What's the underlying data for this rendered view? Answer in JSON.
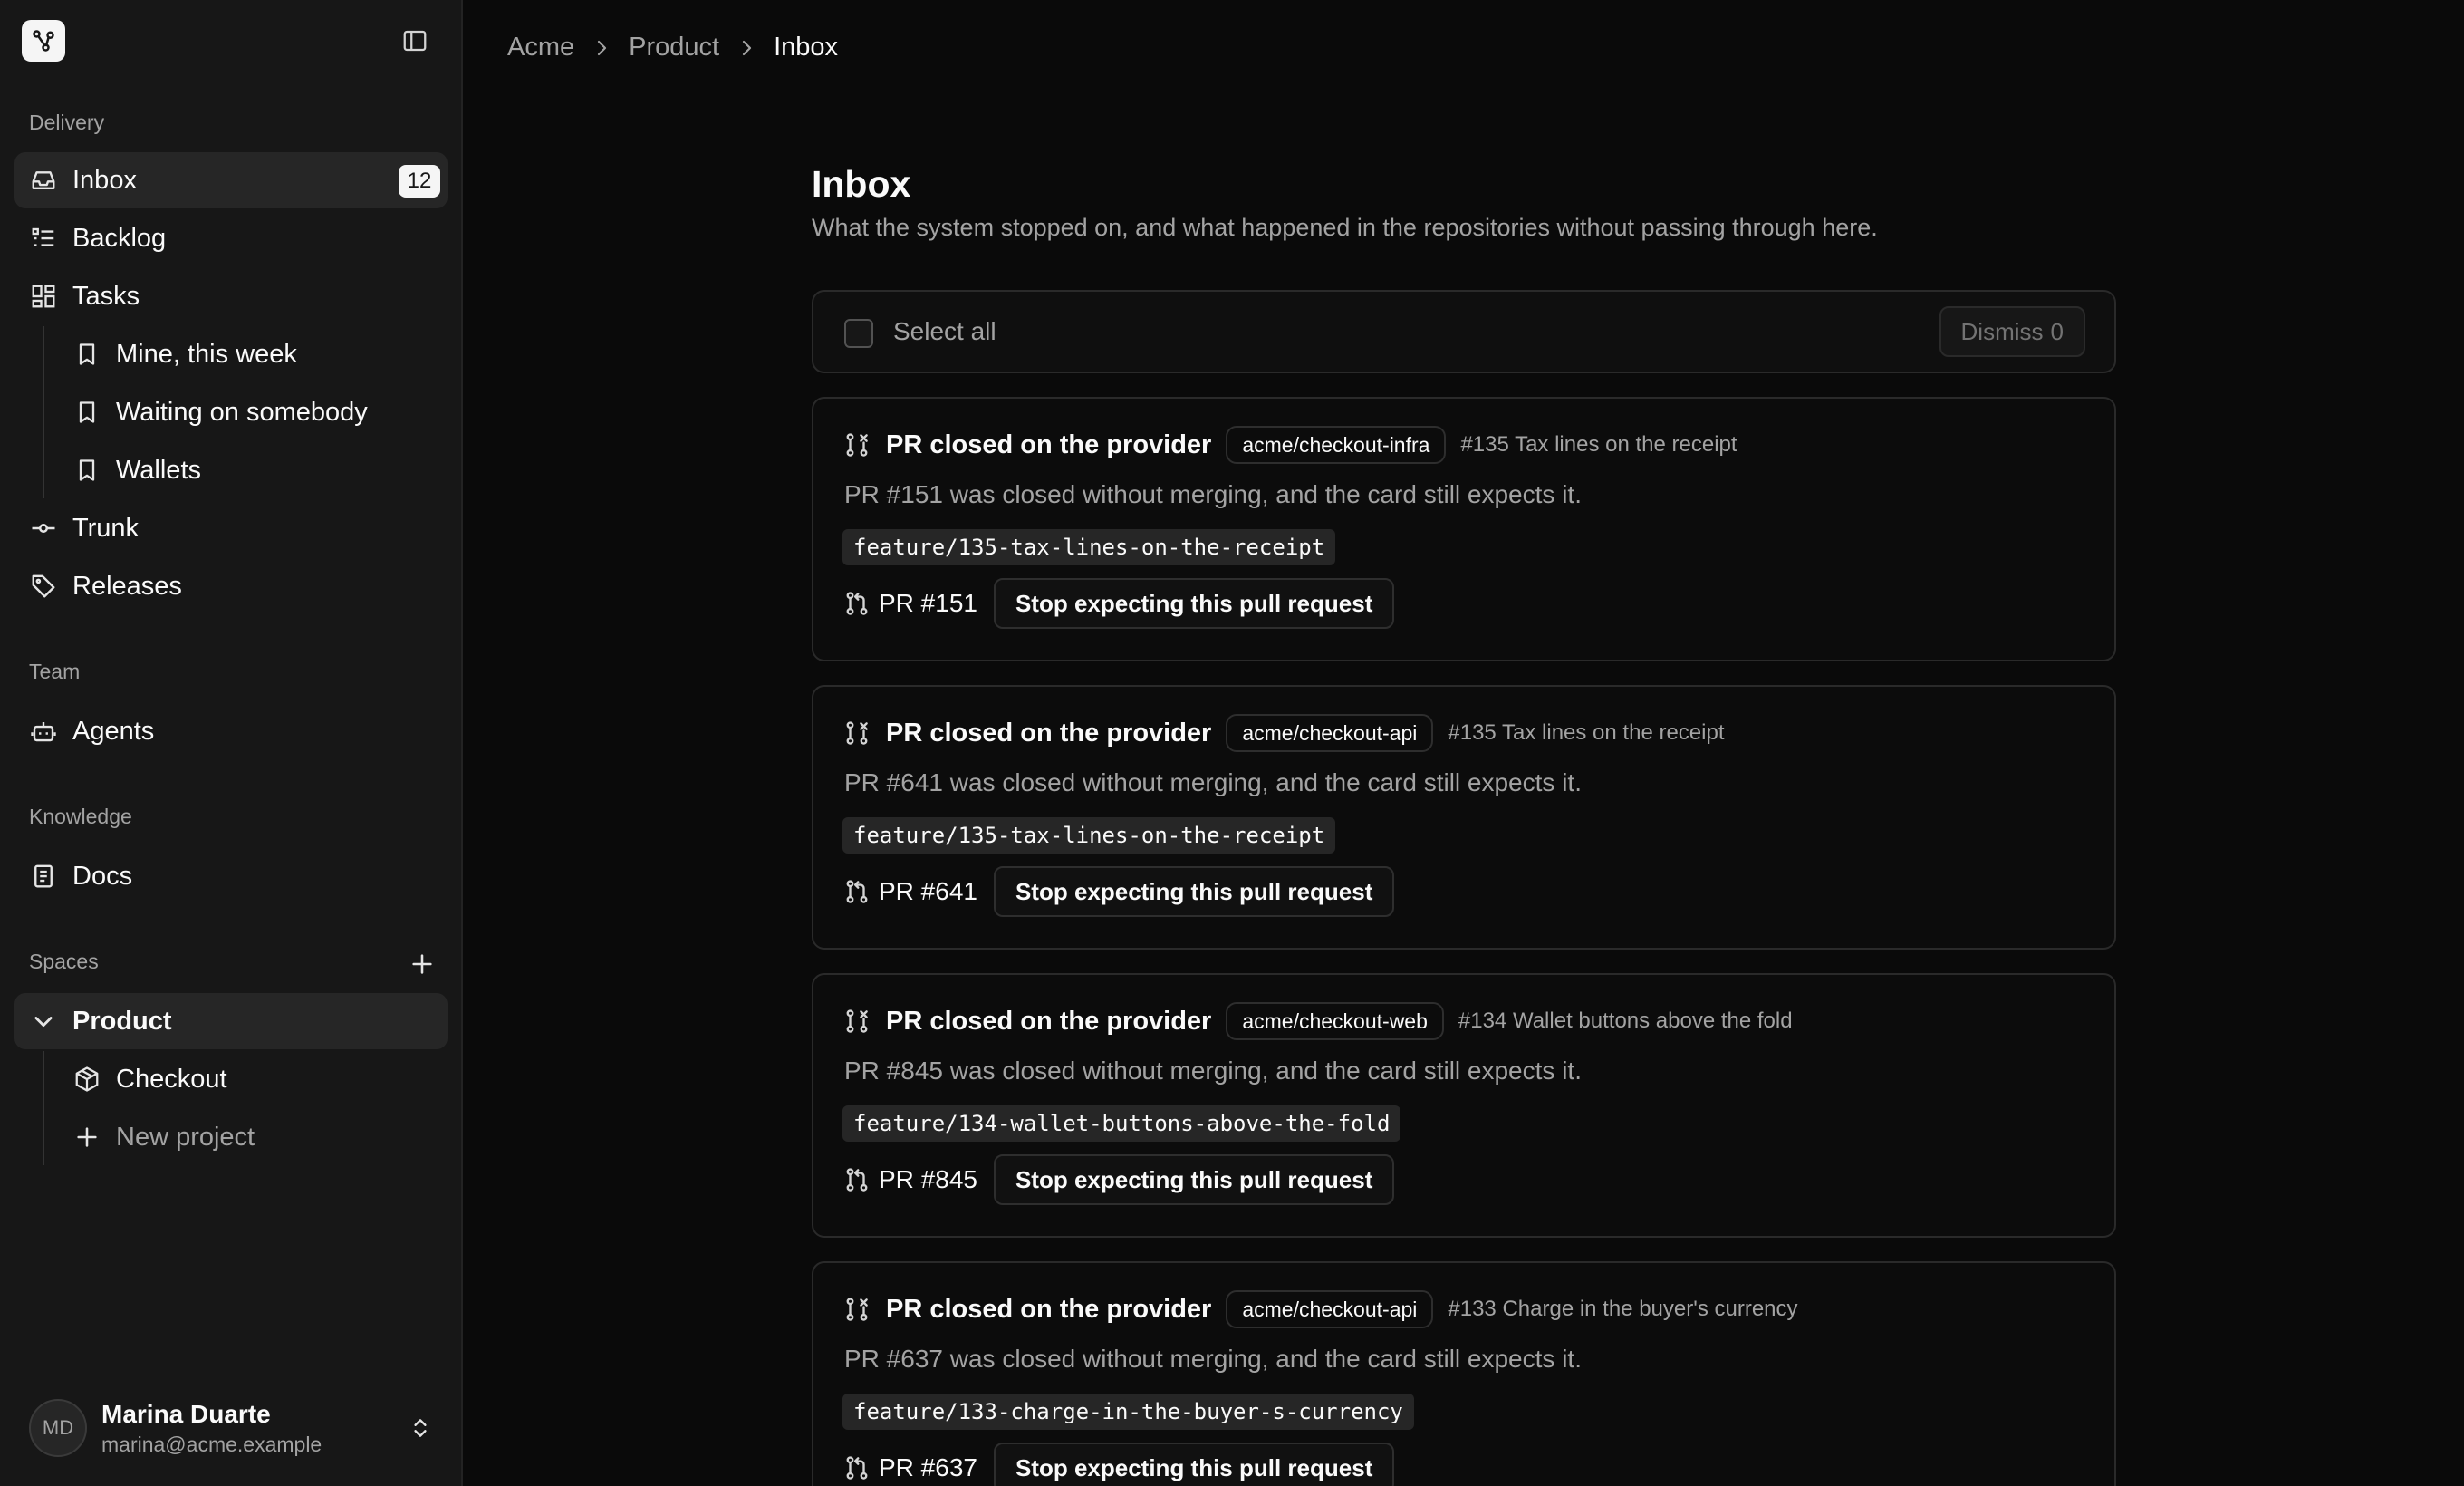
{
  "sidebar": {
    "groups": {
      "delivery": "Delivery",
      "team": "Team",
      "knowledge": "Knowledge",
      "spaces": "Spaces"
    },
    "items": {
      "inbox": {
        "label": "Inbox",
        "badge": "12",
        "icon": "inbox-icon"
      },
      "backlog": {
        "label": "Backlog",
        "icon": "list-icon"
      },
      "tasks": {
        "label": "Tasks",
        "icon": "layout-grid-icon"
      },
      "mine": {
        "label": "Mine, this week",
        "icon": "bookmark-icon"
      },
      "waiting": {
        "label": "Waiting on somebody",
        "icon": "bookmark-icon"
      },
      "wallets": {
        "label": "Wallets",
        "icon": "bookmark-icon"
      },
      "trunk": {
        "label": "Trunk",
        "icon": "git-commit-icon"
      },
      "releases": {
        "label": "Releases",
        "icon": "tag-icon"
      },
      "agents": {
        "label": "Agents",
        "icon": "bot-icon"
      },
      "docs": {
        "label": "Docs",
        "icon": "book-icon"
      },
      "product": {
        "label": "Product",
        "icon": "chevron-down-icon"
      },
      "checkout": {
        "label": "Checkout",
        "icon": "package-icon"
      },
      "new_project": {
        "label": "New project",
        "icon": "plus-icon"
      }
    },
    "user": {
      "initials": "MD",
      "name": "Marina Duarte",
      "email": "marina@acme.example"
    }
  },
  "breadcrumb": [
    "Acme",
    "Product",
    "Inbox"
  ],
  "page": {
    "title": "Inbox",
    "subtitle": "What the system stopped on, and what happened in the repositories without passing through here."
  },
  "selection": {
    "select_all_label": "Select all",
    "dismiss_label": "Dismiss",
    "dismiss_count": "0"
  },
  "cards": [
    {
      "title": "PR closed on the provider",
      "repo": "acme/checkout-infra",
      "issue": "#135 Tax lines on the receipt",
      "description": "PR #151 was closed without merging, and the card still expects it.",
      "branch": "feature/135-tax-lines-on-the-receipt",
      "pr": "PR #151",
      "action": "Stop expecting this pull request"
    },
    {
      "title": "PR closed on the provider",
      "repo": "acme/checkout-api",
      "issue": "#135 Tax lines on the receipt",
      "description": "PR #641 was closed without merging, and the card still expects it.",
      "branch": "feature/135-tax-lines-on-the-receipt",
      "pr": "PR #641",
      "action": "Stop expecting this pull request"
    },
    {
      "title": "PR closed on the provider",
      "repo": "acme/checkout-web",
      "issue": "#134 Wallet buttons above the fold",
      "description": "PR #845 was closed without merging, and the card still expects it.",
      "branch": "feature/134-wallet-buttons-above-the-fold",
      "pr": "PR #845",
      "action": "Stop expecting this pull request"
    },
    {
      "title": "PR closed on the provider",
      "repo": "acme/checkout-api",
      "issue": "#133 Charge in the buyer's currency",
      "description": "PR #637 was closed without merging, and the card still expects it.",
      "branch": "feature/133-charge-in-the-buyer-s-currency",
      "pr": "PR #637",
      "action": "Stop expecting this pull request"
    }
  ]
}
